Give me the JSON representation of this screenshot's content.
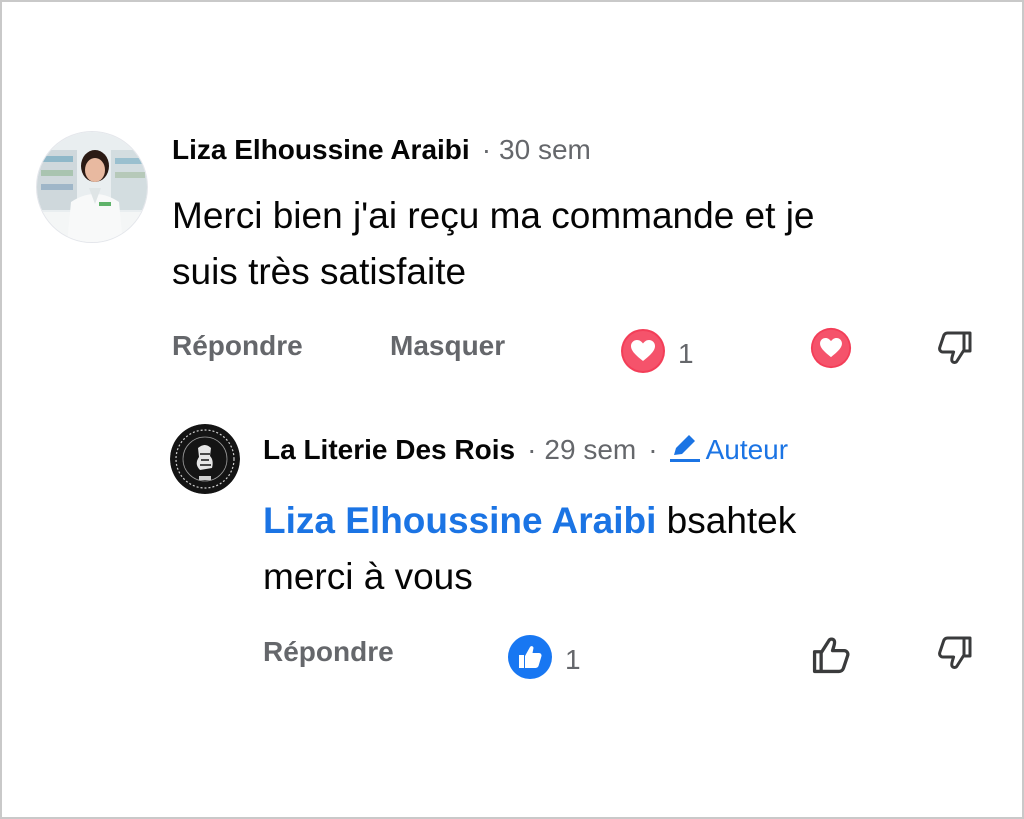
{
  "comment": {
    "author": "Liza Elhoussine Araibi",
    "separator": "·",
    "time": "30 sem",
    "text_line1": "Merci bien j'ai reçu ma commande et je",
    "text_line2": "suis très satisfaite",
    "reply_label": "Répondre",
    "hide_label": "Masquer",
    "reaction": {
      "icon": "love-reaction-icon",
      "count": "1"
    },
    "actions": {
      "love_icon": "love-icon",
      "dislike_icon": "thumbs-down-icon"
    }
  },
  "reply": {
    "author": "La Literie Des Rois",
    "separator": "·",
    "time": "29 sem",
    "separator2": "·",
    "badge_label": "Auteur",
    "badge_icon": "pencil-icon",
    "mention": "Liza Elhoussine Araibi",
    "text_after_mention": " bsahtek",
    "text_line2": "merci à vous",
    "reply_label": "Répondre",
    "reaction": {
      "icon": "like-reaction-icon",
      "count": "1"
    },
    "actions": {
      "like_icon": "thumbs-up-icon",
      "dislike_icon": "thumbs-down-icon"
    }
  },
  "colors": {
    "link_blue": "#1b74e4",
    "muted_gray": "#65676b",
    "love_red": "#f33e58",
    "like_blue": "#1877f2"
  }
}
